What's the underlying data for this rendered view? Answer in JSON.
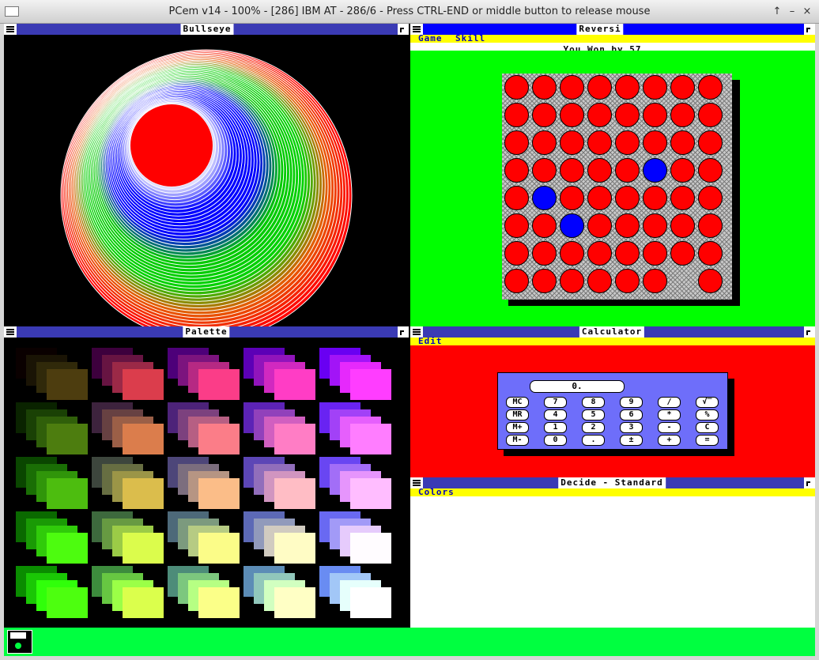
{
  "host": {
    "title": "PCem v14 - 100% - [286] IBM AT - 286/6 - Press CTRL-END or middle button to release mouse",
    "controls": [
      "↑",
      "–",
      "×"
    ]
  },
  "windows": {
    "bullseye": {
      "title": "Bullseye"
    },
    "reversi": {
      "title": "Reversi",
      "menu": [
        "Game",
        "Skill"
      ],
      "status": "You Won by 57",
      "board": [
        "RRRRRRRR",
        "RRRRRRRR",
        "RRRRRRRR",
        "RRRRRBRR",
        "RBRRRRRR",
        "RRBRRRRR",
        "RRRRRRRR",
        "RRRRRR.R"
      ],
      "colors": {
        "background": "#00ff00",
        "board": "#c8c8c8",
        "player": "#ff0000",
        "computer": "#0000ff"
      }
    },
    "palette": {
      "title": "Palette"
    },
    "calculator": {
      "title": "Calculator",
      "menu": [
        "Edit"
      ],
      "display": "0.",
      "keys": [
        [
          "MC",
          "7",
          "8",
          "9",
          "/",
          "√‾"
        ],
        [
          "MR",
          "4",
          "5",
          "6",
          "*",
          "%"
        ],
        [
          "M+",
          "1",
          "2",
          "3",
          "-",
          "C"
        ],
        [
          "M-",
          "0",
          ".",
          "±",
          "+",
          "="
        ]
      ]
    },
    "decide": {
      "title": "Decide - Standard",
      "menu": [
        "Colors"
      ]
    }
  },
  "accent_colors": {
    "title_active": "#0000ff",
    "title_inactive": "#3a3ab4",
    "menubar": "#ffff00",
    "taskbar": "#00ff40"
  },
  "taskbar": {
    "icon": "floppy-disk-icon"
  }
}
